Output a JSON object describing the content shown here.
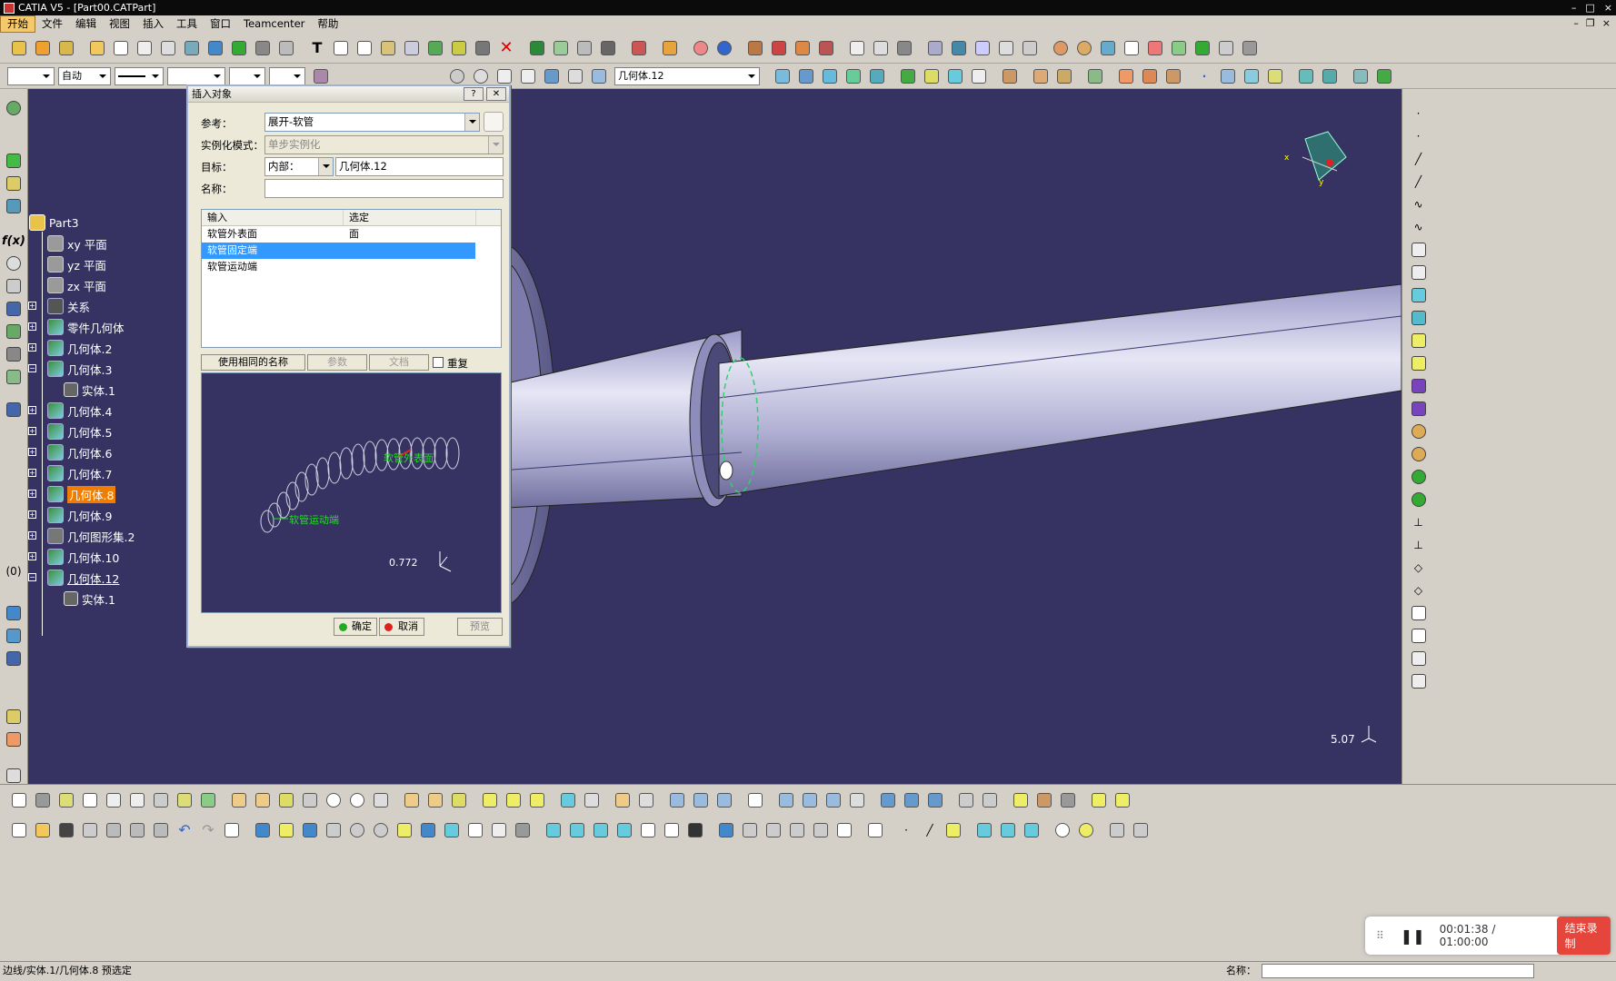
{
  "window": {
    "title": "CATIA V5 - [Part00.CATPart]"
  },
  "menu": {
    "items": [
      "开始",
      "文件",
      "编辑",
      "视图",
      "插入",
      "工具",
      "窗口",
      "Teamcenter",
      "帮助"
    ]
  },
  "toolbar2": {
    "linetype_value": "自动",
    "search_value": "几何体.12"
  },
  "tree": {
    "root": "Part3",
    "items": [
      {
        "label": "xy 平面",
        "kind": "plane"
      },
      {
        "label": "yz 平面",
        "kind": "plane"
      },
      {
        "label": "zx 平面",
        "kind": "plane"
      },
      {
        "label": "关系",
        "kind": "rel"
      },
      {
        "label": "零件几何体",
        "kind": "body"
      },
      {
        "label": "几何体.2",
        "kind": "geo"
      },
      {
        "label": "几何体.3",
        "kind": "geo"
      },
      {
        "label": "实体.1",
        "kind": "solid"
      },
      {
        "label": "几何体.4",
        "kind": "geo"
      },
      {
        "label": "几何体.5",
        "kind": "geo"
      },
      {
        "label": "几何体.6",
        "kind": "geo"
      },
      {
        "label": "几何体.7",
        "kind": "geo"
      },
      {
        "label": "几何体.8",
        "kind": "geo"
      },
      {
        "label": "几何体.9",
        "kind": "geo"
      },
      {
        "label": "几何图形集.2",
        "kind": "set"
      },
      {
        "label": "几何体.10",
        "kind": "geo"
      },
      {
        "label": "几何体.12",
        "kind": "geo"
      },
      {
        "label": "实体.1",
        "kind": "solid"
      }
    ]
  },
  "dialog": {
    "title": "插入对象",
    "reference_label": "参考：",
    "reference_value": "展开-软管",
    "instantiation_label": "实例化模式：",
    "instantiation_value": "单步实例化",
    "target_label": "目标：",
    "target_mode": "内部：",
    "target_value": "几何体.12",
    "name_label": "名称：",
    "name_value": "",
    "columns": [
      "输入",
      "选定"
    ],
    "rows": [
      {
        "input": "软管外表面",
        "selected": "面"
      },
      {
        "input": "软管固定端",
        "selected": ""
      },
      {
        "input": "软管运动端",
        "selected": ""
      }
    ],
    "use_same_name": "使用相同的名称",
    "params_button": "参数",
    "doc_button": "文档",
    "repeat_label": "重复",
    "preview_label_outer": "软管外表面",
    "preview_label_moving": "软管运动端",
    "preview_scale": "0.772",
    "ok": "确定",
    "cancel": "取消",
    "preview": "预览"
  },
  "viewport": {
    "scale": "5.07"
  },
  "status": {
    "text": "边线/实体.1/几何体.8 预选定",
    "name_label": "名称："
  },
  "recorder": {
    "time": "00:01:38 / 01:00:00",
    "stop_label": "结束录制"
  },
  "colors": {
    "background": "#363362",
    "selection": "#f07c00",
    "accent_green": "#22dd22",
    "dialog_bg": "#ece9d8"
  }
}
